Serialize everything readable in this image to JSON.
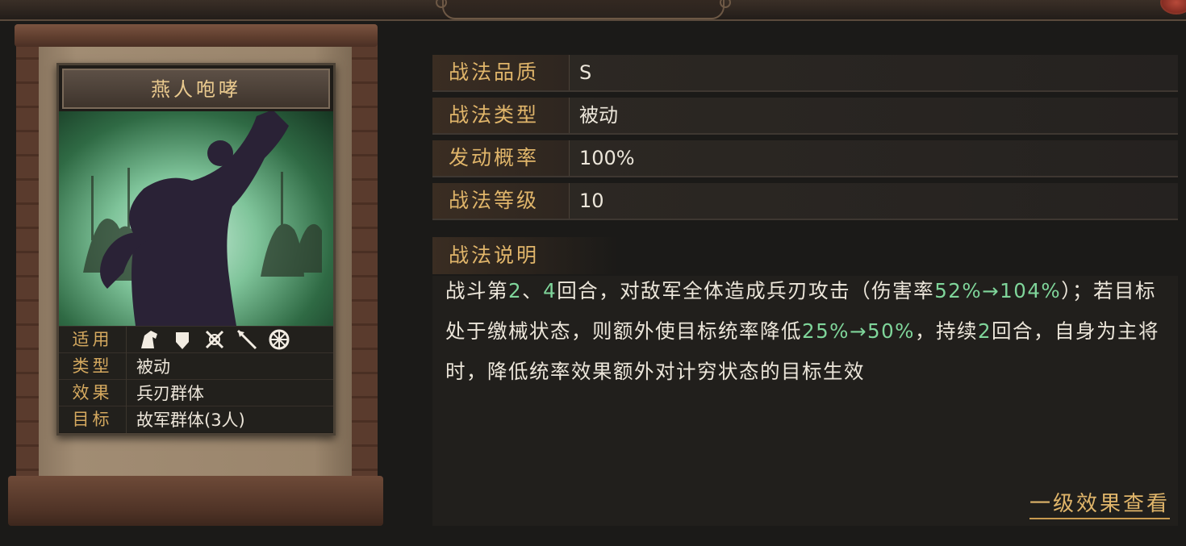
{
  "card": {
    "title": "燕人咆哮",
    "rows": [
      {
        "key": "适用",
        "icons": [
          "cavalry-icon",
          "shield-icon",
          "archer-icon",
          "spear-icon",
          "siege-icon"
        ]
      },
      {
        "key": "类型",
        "value": "被动"
      },
      {
        "key": "效果",
        "value": "兵刃群体"
      },
      {
        "key": "目标",
        "value": "故军群体(3人)"
      }
    ]
  },
  "stats": [
    {
      "key": "战法品质",
      "value": "S"
    },
    {
      "key": "战法类型",
      "value": "被动"
    },
    {
      "key": "发动概率",
      "value": "100%"
    },
    {
      "key": "战法等级",
      "value": "10"
    }
  ],
  "description": {
    "heading": "战法说明",
    "segments": [
      {
        "t": "战斗第",
        "hl": false
      },
      {
        "t": "2",
        "hl": true
      },
      {
        "t": "、",
        "hl": false
      },
      {
        "t": "4",
        "hl": true
      },
      {
        "t": "回合，对敌军全体造成兵刃攻击（伤害率",
        "hl": false
      },
      {
        "t": "52%→104%",
        "hl": true
      },
      {
        "t": "）；若目标处于缴械状态，则额外使目标统率降低",
        "hl": false
      },
      {
        "t": "25%→50%",
        "hl": true
      },
      {
        "t": "，持续",
        "hl": false
      },
      {
        "t": "2",
        "hl": true
      },
      {
        "t": "回合，自身为主将时，降低统率效果额外对计穷状态的目标生效",
        "hl": false
      }
    ]
  },
  "link": {
    "label": "一级效果查看"
  },
  "colors": {
    "gold": "#e0b56a",
    "highlight": "#7fd59a",
    "text": "#ece6da"
  }
}
